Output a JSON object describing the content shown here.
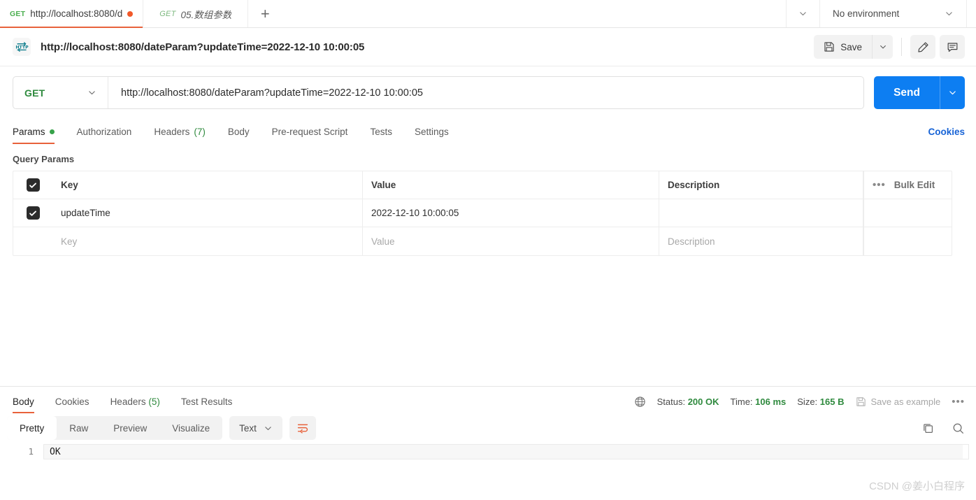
{
  "tabbar": {
    "tabs": [
      {
        "method": "GET",
        "name": "http://localhost:8080/d",
        "dirty": true,
        "active": true
      },
      {
        "method": "GET",
        "name": "05.数组参数",
        "dirty": false,
        "active": false
      }
    ],
    "add_label": "+",
    "environment": "No environment"
  },
  "request_header": {
    "icon": "http-icon",
    "title": "http://localhost:8080/dateParam?updateTime=2022-12-10 10:00:05",
    "save_label": "Save",
    "edit_icon": "pencil-icon",
    "comment_icon": "comment-icon"
  },
  "url_bar": {
    "method": "GET",
    "url": "http://localhost:8080/dateParam?updateTime=2022-12-10 10:00:05",
    "send_label": "Send"
  },
  "request_tabs": [
    {
      "label": "Params",
      "dot": true,
      "active": true
    },
    {
      "label": "Authorization",
      "active": false
    },
    {
      "label": "Headers",
      "count": "(7)",
      "active": false
    },
    {
      "label": "Body",
      "active": false
    },
    {
      "label": "Pre-request Script",
      "active": false
    },
    {
      "label": "Tests",
      "active": false
    },
    {
      "label": "Settings",
      "active": false
    }
  ],
  "cookies_link": "Cookies",
  "query_params": {
    "section_title": "Query Params",
    "headers": {
      "key": "Key",
      "value": "Value",
      "description": "Description"
    },
    "bulk_edit_label": "Bulk Edit",
    "rows": [
      {
        "checked": true,
        "key": "updateTime",
        "value": "2022-12-10 10:00:05",
        "description": ""
      }
    ],
    "placeholder_row": {
      "key": "Key",
      "value": "Value",
      "description": "Description"
    }
  },
  "response": {
    "tabs": [
      {
        "label": "Body",
        "active": true
      },
      {
        "label": "Cookies",
        "active": false
      },
      {
        "label": "Headers",
        "count": "(5)",
        "active": false
      },
      {
        "label": "Test Results",
        "active": false
      }
    ],
    "status_label": "Status:",
    "status_value": "200 OK",
    "time_label": "Time:",
    "time_value": "106 ms",
    "size_label": "Size:",
    "size_value": "165 B",
    "save_example_label": "Save as example",
    "view_modes": [
      {
        "label": "Pretty",
        "active": true
      },
      {
        "label": "Raw",
        "active": false
      },
      {
        "label": "Preview",
        "active": false
      },
      {
        "label": "Visualize",
        "active": false
      }
    ],
    "format": "Text",
    "body_lines": [
      {
        "num": "1",
        "text": "OK"
      }
    ]
  },
  "watermark": "CSDN @姜小白程序",
  "colors": {
    "accent_orange": "#e8623b",
    "send_blue": "#0d7ef2",
    "green": "#2f8a3e",
    "link_blue": "#1763d6"
  }
}
